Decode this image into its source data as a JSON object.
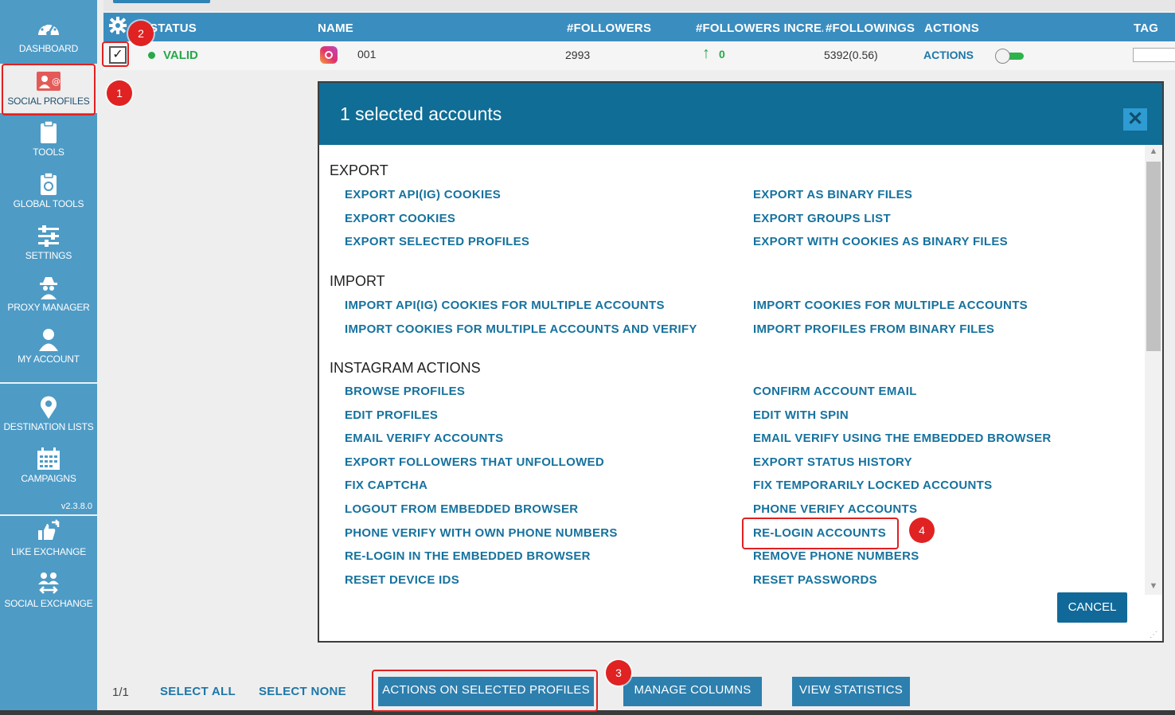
{
  "sidebar": {
    "items": [
      {
        "label": "DASHBOARD",
        "icon": "dashboard-icon"
      },
      {
        "label": "SOCIAL PROFILES",
        "icon": "social-profiles-icon"
      },
      {
        "label": "TOOLS",
        "icon": "clipboard-icon"
      },
      {
        "label": "GLOBAL TOOLS",
        "icon": "globe-clipboard-icon"
      },
      {
        "label": "SETTINGS",
        "icon": "sliders-icon"
      },
      {
        "label": "PROXY MANAGER",
        "icon": "spy-icon"
      },
      {
        "label": "MY ACCOUNT",
        "icon": "user-icon"
      },
      {
        "label": "DESTINATION LISTS",
        "icon": "map-pin-icon"
      },
      {
        "label": "CAMPAIGNS",
        "icon": "calendar-icon"
      },
      {
        "label": "LIKE EXCHANGE",
        "icon": "thumbs-exchange-icon"
      },
      {
        "label": "SOCIAL EXCHANGE",
        "icon": "people-exchange-icon"
      }
    ],
    "version": "v2.3.8.0",
    "active_color": "#eeeeee",
    "bg_color": "#4e9bc6"
  },
  "table": {
    "headers": {
      "status": "STATUS",
      "name": "NAME",
      "followers": "#FOLLOWERS",
      "followers_increase": "#FOLLOWERS INCREA",
      "followings": "#FOLLOWINGS",
      "actions": "ACTIONS",
      "tag": "TAG"
    },
    "row": {
      "checked": true,
      "check_glyph": "✓",
      "status": "VALID",
      "network_icon": "instagram-icon",
      "name": "001",
      "followers": "2993",
      "increase_arrow": "↑",
      "followers_increase": "0",
      "followings": "5392(0.56)",
      "actions_label": "ACTIONS",
      "toggle_on": true,
      "tag": ""
    },
    "header_color": "#3a8dbf"
  },
  "modal": {
    "title": "1 selected accounts",
    "close_glyph": "✕",
    "sections": [
      {
        "title": "EXPORT",
        "left": [
          "EXPORT API(IG) COOKIES",
          "EXPORT COOKIES",
          "EXPORT SELECTED PROFILES"
        ],
        "right": [
          "EXPORT AS BINARY FILES",
          "EXPORT GROUPS LIST",
          "EXPORT WITH COOKIES AS BINARY FILES"
        ]
      },
      {
        "title": "IMPORT",
        "left": [
          "IMPORT API(IG) COOKIES FOR MULTIPLE ACCOUNTS",
          "IMPORT COOKIES FOR MULTIPLE ACCOUNTS AND VERIFY"
        ],
        "right": [
          "IMPORT COOKIES FOR MULTIPLE ACCOUNTS",
          "IMPORT PROFILES FROM BINARY FILES"
        ]
      },
      {
        "title": "INSTAGRAM ACTIONS",
        "left": [
          "BROWSE PROFILES",
          "EDIT PROFILES",
          "EMAIL VERIFY ACCOUNTS",
          "EXPORT FOLLOWERS THAT UNFOLLOWED",
          "FIX CAPTCHA",
          "LOGOUT FROM EMBEDDED BROWSER",
          "PHONE VERIFY WITH OWN PHONE NUMBERS",
          "RE-LOGIN IN THE EMBEDDED BROWSER",
          "RESET DEVICE IDS"
        ],
        "right": [
          "CONFIRM ACCOUNT EMAIL",
          "EDIT WITH SPIN",
          "EMAIL VERIFY USING THE EMBEDDED BROWSER",
          "EXPORT STATUS HISTORY",
          "FIX TEMPORARILY LOCKED ACCOUNTS",
          "PHONE VERIFY ACCOUNTS",
          "RE-LOGIN ACCOUNTS",
          "REMOVE PHONE NUMBERS",
          "RESET PASSWORDS"
        ]
      }
    ],
    "cancel_label": "CANCEL",
    "header_color": "#0f6d96",
    "link_color": "#16729e"
  },
  "footer": {
    "pager": "1/1",
    "select_all": "SELECT ALL",
    "select_none": "SELECT NONE",
    "actions_button": "ACTIONS ON SELECTED PROFILES",
    "manage_columns": "MANAGE COLUMNS",
    "view_statistics": "VIEW STATISTICS"
  },
  "annotations": {
    "badges": [
      "1",
      "2",
      "3",
      "4"
    ],
    "color": "#e02222"
  }
}
